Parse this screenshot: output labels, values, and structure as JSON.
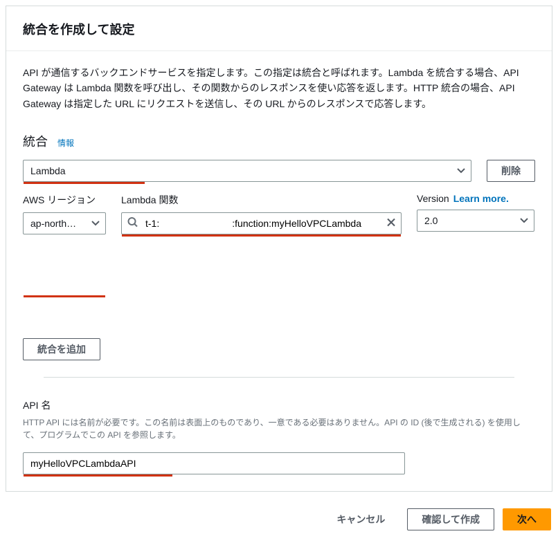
{
  "header": {
    "title": "統合を作成して設定"
  },
  "description": "API が通信するバックエンドサービスを指定します。この指定は統合と呼ばれます。Lambda を統合する場合、API Gateway は Lambda 関数を呼び出し、その関数からのレスポンスを使い応答を返します。HTTP 統合の場合、API Gateway は指定した URL にリクエストを送信し、その URL からのレスポンスで応答します。",
  "integration": {
    "section_title": "統合",
    "info_label": "情報",
    "type_value": "Lambda",
    "delete_label": "削除",
    "region_label": "AWS リージョン",
    "region_value": "ap-north…",
    "lambda_label": "Lambda 関数",
    "lambda_value": "t-1:                           :function:myHelloVPCLambda",
    "version_label": "Version",
    "learn_more": "Learn more.",
    "version_value": "2.0",
    "add_label": "統合を追加"
  },
  "api_name": {
    "label": "API 名",
    "description": "HTTP API には名前が必要です。この名前は表面上のものであり、一意である必要はありません。API の ID (後で生成される) を使用して、プログラムでこの API を参照します。",
    "value": "myHelloVPCLambdaAPI"
  },
  "footer": {
    "cancel": "キャンセル",
    "review": "確認して作成",
    "next": "次へ"
  }
}
